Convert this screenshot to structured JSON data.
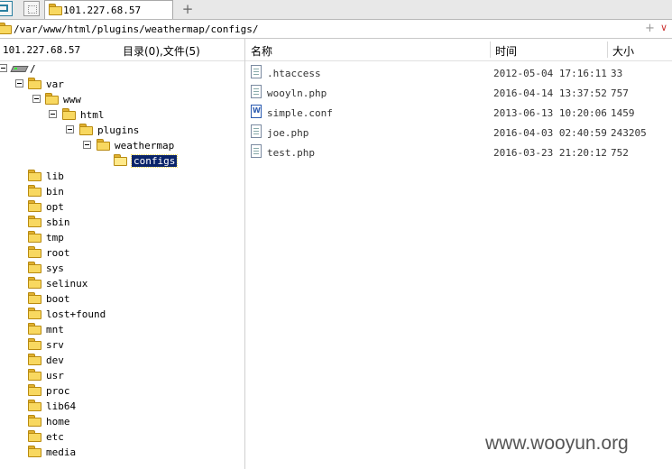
{
  "tab": {
    "title": "101.227.68.57",
    "new_tab": "+"
  },
  "address": {
    "path": "/var/www/html/plugins/weathermap/configs/",
    "plus": "+",
    "chevron": "∨"
  },
  "left": {
    "host": "101.227.68.57",
    "counts": "目录(0),文件(5)",
    "tree": [
      {
        "label": "/",
        "icon": "drive-icon",
        "expanded": true
      },
      {
        "label": "var",
        "icon": "folder-icon",
        "expanded": true
      },
      {
        "label": "www",
        "icon": "folder-icon",
        "expanded": true
      },
      {
        "label": "html",
        "icon": "folder-icon",
        "expanded": true
      },
      {
        "label": "plugins",
        "icon": "folder-icon",
        "expanded": true
      },
      {
        "label": "weathermap",
        "icon": "folder-icon",
        "expanded": true
      },
      {
        "label": "configs",
        "icon": "folder-open-icon",
        "selected": true
      },
      {
        "label": "lib",
        "icon": "folder-icon"
      },
      {
        "label": "bin",
        "icon": "folder-icon"
      },
      {
        "label": "opt",
        "icon": "folder-icon"
      },
      {
        "label": "sbin",
        "icon": "folder-icon"
      },
      {
        "label": "tmp",
        "icon": "folder-icon"
      },
      {
        "label": "root",
        "icon": "folder-icon"
      },
      {
        "label": "sys",
        "icon": "folder-icon"
      },
      {
        "label": "selinux",
        "icon": "folder-icon"
      },
      {
        "label": "boot",
        "icon": "folder-icon"
      },
      {
        "label": "lost+found",
        "icon": "folder-icon"
      },
      {
        "label": "mnt",
        "icon": "folder-icon"
      },
      {
        "label": "srv",
        "icon": "folder-icon"
      },
      {
        "label": "dev",
        "icon": "folder-icon"
      },
      {
        "label": "usr",
        "icon": "folder-icon"
      },
      {
        "label": "proc",
        "icon": "folder-icon"
      },
      {
        "label": "lib64",
        "icon": "folder-icon"
      },
      {
        "label": "home",
        "icon": "folder-icon"
      },
      {
        "label": "etc",
        "icon": "folder-icon"
      },
      {
        "label": "media",
        "icon": "folder-icon"
      }
    ]
  },
  "right": {
    "columns": {
      "name": "名称",
      "time": "时间",
      "size": "大小"
    },
    "files": [
      {
        "name": ".htaccess",
        "time": "2012-05-04 17:16:11",
        "size": "33",
        "icon": "file-icon"
      },
      {
        "name": "wooyln.php",
        "time": "2016-04-14 13:37:52",
        "size": "757",
        "icon": "file-icon"
      },
      {
        "name": "simple.conf",
        "time": "2013-06-13 10:20:06",
        "size": "1459",
        "icon": "word-file-icon"
      },
      {
        "name": "joe.php",
        "time": "2016-04-03 02:40:59",
        "size": "243205",
        "icon": "file-icon"
      },
      {
        "name": "test.php",
        "time": "2016-03-23 21:20:12",
        "size": "752",
        "icon": "file-icon"
      }
    ]
  },
  "watermark": "www.wooyun.org"
}
